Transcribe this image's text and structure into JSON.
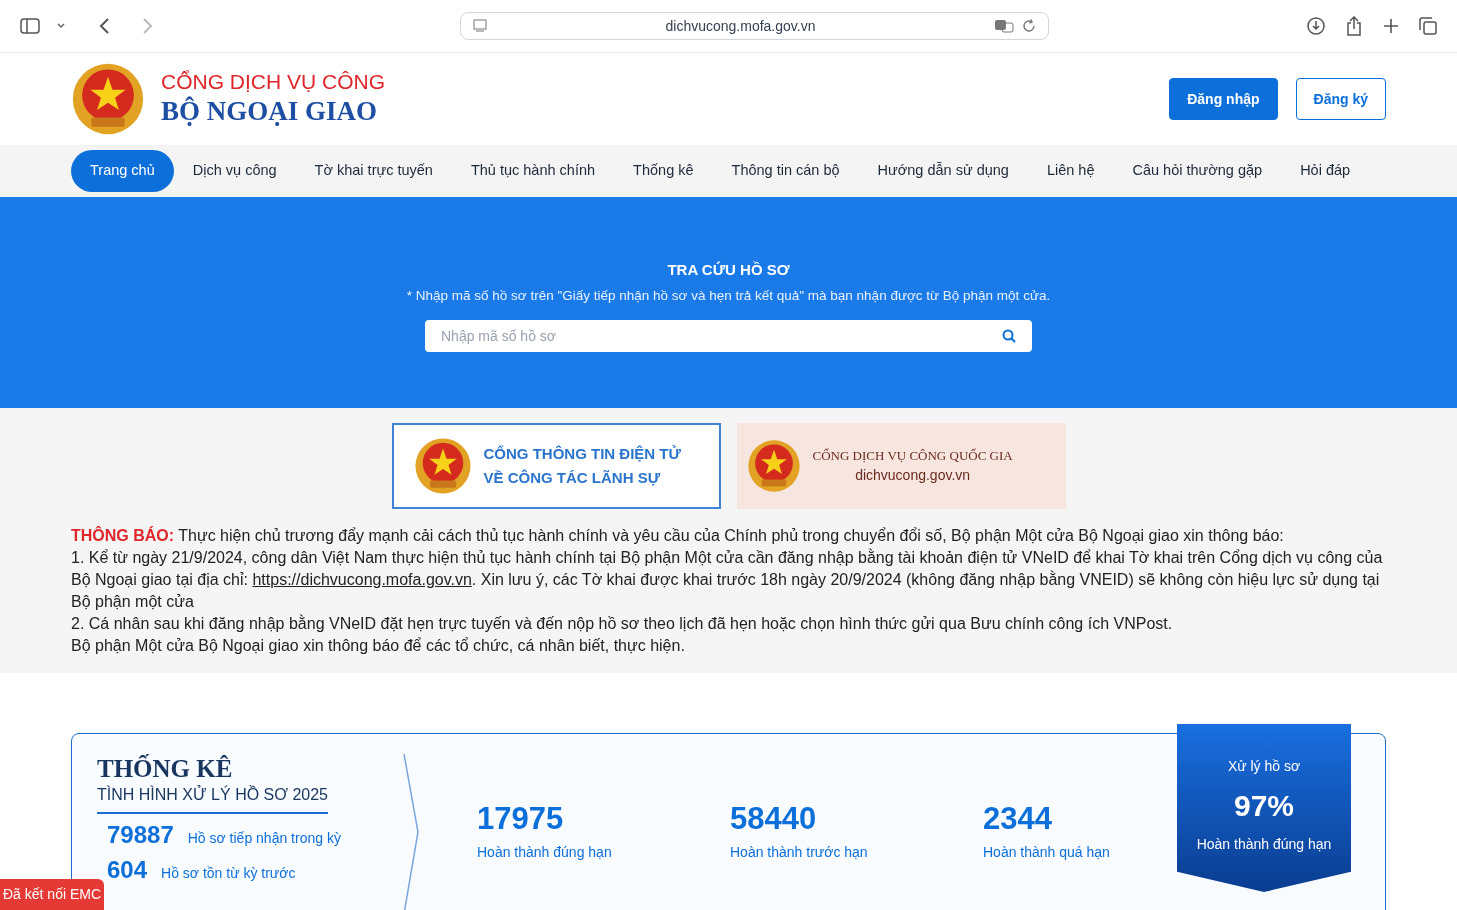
{
  "browser": {
    "url": "dichvucong.mofa.gov.vn"
  },
  "header": {
    "logo_top": "CỔNG DỊCH VỤ CÔNG",
    "logo_bottom": "BỘ NGOẠI GIAO",
    "buttons": [
      {
        "label": "Đăng nhập",
        "kind": "primary"
      },
      {
        "label": "Đăng ký",
        "kind": "outline"
      }
    ]
  },
  "nav": [
    {
      "label": "Trang chủ",
      "selected": true
    },
    {
      "label": "Dịch vụ công",
      "selected": false
    },
    {
      "label": "Tờ khai trực tuyến",
      "selected": false
    },
    {
      "label": "Thủ tục hành chính",
      "selected": false
    },
    {
      "label": "Thống kê",
      "selected": false
    },
    {
      "label": "Thông tin cán bộ",
      "selected": false
    },
    {
      "label": "Hướng dẫn sử dụng",
      "selected": false
    },
    {
      "label": "Liên hệ",
      "selected": false
    },
    {
      "label": "Câu hỏi thường gặp",
      "selected": false
    },
    {
      "label": "Hỏi đáp",
      "selected": false
    }
  ],
  "search": {
    "title": "TRA CỨU HỒ SƠ",
    "hint": "* Nhập mã số hồ sơ trên \"Giấy tiếp nhận hồ sơ và hẹn trả kết quả\" mà bạn nhận được từ Bộ phận một cửa.",
    "placeholder": "Nhập mã số hồ sơ"
  },
  "banners": [
    {
      "kind": "consular",
      "line_1": "CỔNG THÔNG TIN ĐIỆN TỬ",
      "line_2": "VỀ CÔNG TÁC LÃNH SỰ"
    },
    {
      "kind": "national",
      "line_1": "CỔNG DỊCH VỤ CÔNG QUỐC GIA",
      "line_2": "dichvucong.gov.vn"
    }
  ],
  "notice": {
    "label": "THÔNG BÁO:",
    "intro": "Thực hiện chủ trương đẩy mạnh cải cách thủ tục hành chính và yêu cầu của Chính phủ trong chuyển đổi số, Bộ phận Một cửa Bộ Ngoại giao xin thông báo:",
    "item_1_before": "1. Kể từ ngày 21/9/2024, công dân Việt Nam thực hiện thủ tục hành chính tại Bộ phận Một cửa cần đăng nhập bằng tài khoản điện tử VNeID để khai Tờ khai trên Cổng dịch vụ công của Bộ Ngoại giao tại địa chỉ: ",
    "item_1_link": "https://dichvucong.mofa.gov.vn",
    "item_1_after": ". Xin lưu ý, các Tờ khai được khai trước 18h ngày 20/9/2024 (không đăng nhập bằng VNEID) sẽ không còn hiệu lực sử dụng tại Bộ phận một cửa",
    "item_2": "2. Cá nhân sau khi đăng nhập bằng VNeID đặt hẹn trực tuyến và đến nộp hồ sơ theo lịch đã hẹn hoặc chọn hình thức gửi qua Bưu chính công ích VNPost.",
    "closing": "Bộ phận Một cửa Bộ Ngoại giao xin thông báo để các tổ chức, cá nhân biết, thực hiện."
  },
  "stats": {
    "title": "THỐNG KÊ",
    "subtitle": "TÌNH HÌNH XỬ LÝ HỒ SƠ 2025",
    "totals": [
      {
        "value": "79887",
        "label": "Hồ sơ tiếp nhận trong kỳ"
      },
      {
        "value": "604",
        "label": "Hồ sơ tồn từ kỳ trước"
      }
    ],
    "results": [
      {
        "value": "17975",
        "label": "Hoàn thành đúng hạn"
      },
      {
        "value": "58440",
        "label": "Hoàn thành trước hạn"
      },
      {
        "value": "2344",
        "label": "Hoàn thành quá hạn"
      }
    ],
    "ribbon": {
      "caption": "Xử lý hồ sơ",
      "value": "97%",
      "label": "Hoàn thành đúng hạn"
    }
  },
  "connection_badge": "Đã kết nối EMC"
}
